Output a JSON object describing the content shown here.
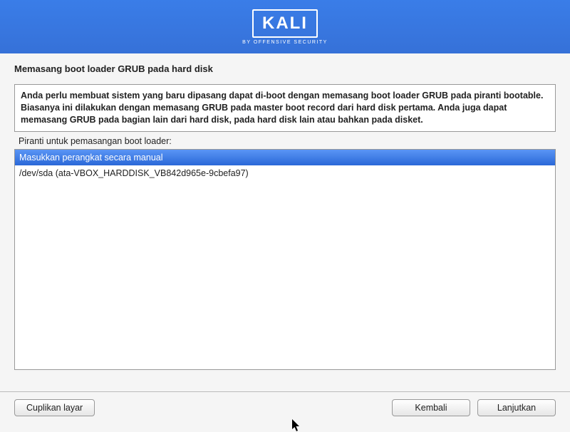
{
  "brand": {
    "name": "KALI",
    "subtitle": "BY OFFENSIVE SECURITY"
  },
  "page_title": "Memasang boot loader GRUB pada hard disk",
  "instruction": "Anda perlu membuat sistem yang baru dipasang dapat di-boot dengan memasang boot loader GRUB pada piranti bootable. Biasanya ini dilakukan dengan memasang GRUB pada master boot record dari hard disk pertama. Anda juga dapat memasang GRUB pada bagian lain dari hard disk, pada hard disk lain atau bahkan pada disket.",
  "field_label": "Piranti untuk pemasangan boot loader:",
  "devices": [
    {
      "label": "Masukkan perangkat secara manual",
      "selected": true
    },
    {
      "label": "/dev/sda  (ata-VBOX_HARDDISK_VB842d965e-9cbefa97)",
      "selected": false
    }
  ],
  "buttons": {
    "screenshot": "Cuplikan layar",
    "back": "Kembali",
    "continue": "Lanjutkan"
  }
}
